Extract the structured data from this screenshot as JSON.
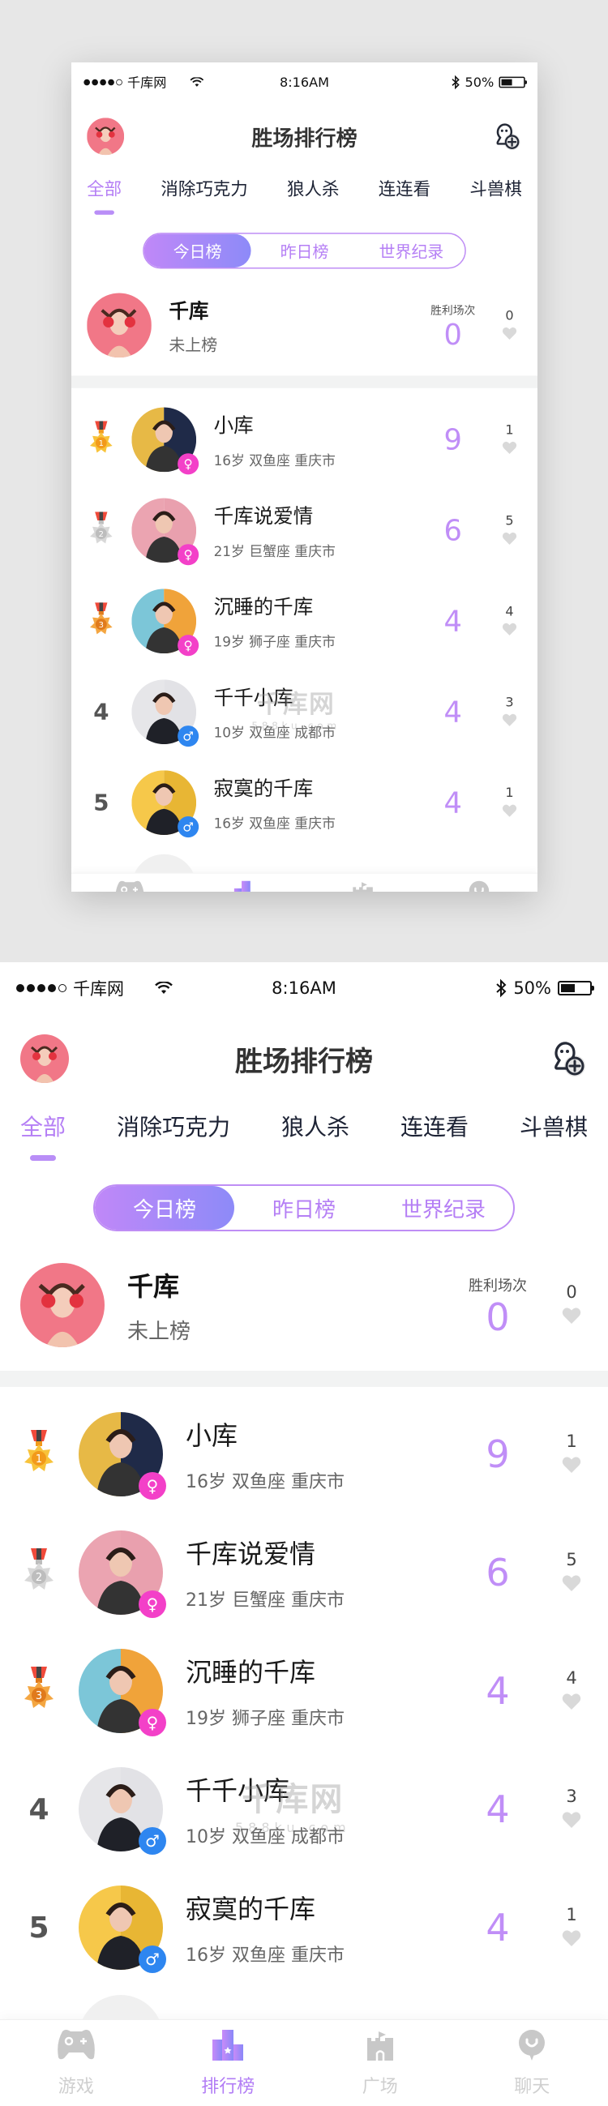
{
  "statusbar": {
    "carrier": "千库网",
    "time": "8:16AM",
    "battery_label": "50%",
    "battery_level": 0.5,
    "signal_bars_filled": 4,
    "signal_bars_total": 5
  },
  "header": {
    "title": "胜场排行榜",
    "avatar_icon": "user-avatar",
    "action_icon": "add-friend-icon"
  },
  "category_tabs": [
    {
      "label": "全部",
      "active": true
    },
    {
      "label": "消除巧克力",
      "active": false
    },
    {
      "label": "狼人杀",
      "active": false
    },
    {
      "label": "连连看",
      "active": false
    },
    {
      "label": "斗兽棋",
      "active": false
    }
  ],
  "period_tabs": [
    {
      "label": "今日榜",
      "active": true
    },
    {
      "label": "昨日榜",
      "active": false
    },
    {
      "label": "世界纪录",
      "active": false
    }
  ],
  "me": {
    "name": "千库",
    "status": "未上榜",
    "wins_label": "胜利场次",
    "wins": "0",
    "likes": "0"
  },
  "ranking": [
    {
      "rank": "1",
      "medal": "gold",
      "name": "小库",
      "meta": "16岁 双鱼座 重庆市",
      "gender": "female",
      "wins": "9",
      "likes": "1",
      "avatar_bg": [
        "#e7b946",
        "#1f2a48"
      ]
    },
    {
      "rank": "2",
      "medal": "silver",
      "name": "千库说爱情",
      "meta": "21岁 巨蟹座 重庆市",
      "gender": "female",
      "wins": "6",
      "likes": "5",
      "avatar_bg": [
        "#eba4b1",
        "#e9a0ae"
      ]
    },
    {
      "rank": "3",
      "medal": "bronze",
      "name": "沉睡的千库",
      "meta": "19岁 狮子座 重庆市",
      "gender": "female",
      "wins": "4",
      "likes": "4",
      "avatar_bg": [
        "#7cc6d8",
        "#f0a33a"
      ]
    },
    {
      "rank": "4",
      "medal": null,
      "name": "千千小库",
      "meta": "10岁 双鱼座 成都市",
      "gender": "male",
      "wins": "4",
      "likes": "3",
      "avatar_bg": [
        "#e6e6e9",
        "#e2e2e6"
      ]
    },
    {
      "rank": "5",
      "medal": null,
      "name": "寂寞的千库",
      "meta": "16岁 双鱼座 重庆市",
      "gender": "male",
      "wins": "4",
      "likes": "1",
      "avatar_bg": [
        "#f6c84a",
        "#e8b634"
      ]
    }
  ],
  "gender_symbols": {
    "female": "♀",
    "male": "♂"
  },
  "tabbar": [
    {
      "label": "游戏",
      "icon": "gamepad-icon",
      "active": false
    },
    {
      "label": "排行榜",
      "icon": "ranking-icon",
      "active": true
    },
    {
      "label": "广场",
      "icon": "castle-icon",
      "active": false
    },
    {
      "label": "聊天",
      "icon": "chat-bubble-icon",
      "active": false
    }
  ],
  "colors": {
    "accent": "#b57ff5",
    "accent_gradient_end": "#8d8af8",
    "female": "#f340c8",
    "male": "#2e86f0",
    "inactive": "#cfcfcf"
  },
  "watermark": {
    "main": "千库网",
    "sub": "588ku.com"
  }
}
